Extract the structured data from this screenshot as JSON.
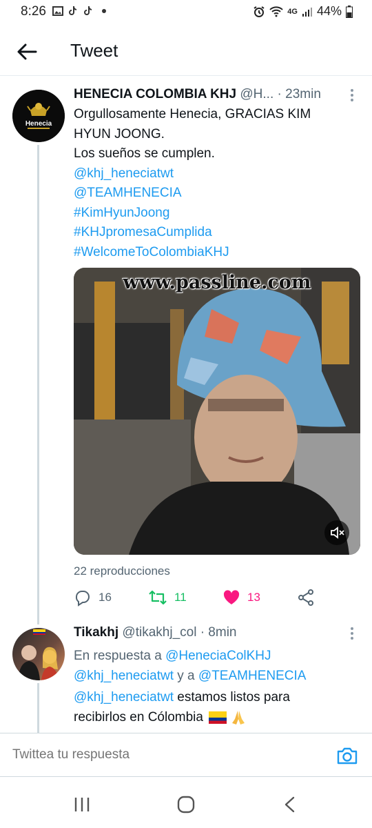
{
  "status_bar": {
    "time": "8:26",
    "network": "4G",
    "battery": "44%"
  },
  "header": {
    "title": "Tweet"
  },
  "tweet": {
    "author_name": "HENECIA COLOMBIA KHJ",
    "author_handle": "@H...",
    "time": "· 23min",
    "text_line1": "Orgullosamente Henecia, GRACIAS KIM",
    "text_line2": "HYUN JOONG.",
    "text_line3": "Los sueños se cumplen.",
    "links": [
      "@khj_heneciatwt",
      "@TEAMHENECIA",
      "#KimHyunJoong",
      "#KHJpromesaCumplida",
      "#WelcomeToColombiaKHJ"
    ],
    "avatar_text": "Henecia",
    "media_watermark": "www.passline.com",
    "views": "22 reproducciones",
    "reply_count": "16",
    "retweet_count": "11",
    "like_count": "13"
  },
  "reply": {
    "author_name": "Tikakhj",
    "author_handle": "@tikakhj_col",
    "time": "· 8min",
    "reply_prefix": "En respuesta a",
    "reply_mention1": "@HeneciaColKHJ",
    "reply_mention2": "@khj_heneciatwt",
    "reply_and": "y a",
    "reply_mention3": "@TEAMHENECIA",
    "text_mention": "@khj_heneciatwt",
    "text_part1": "estamos listos para",
    "text_part2": "recibirlos en Cólombia"
  },
  "composer": {
    "placeholder": "Twittea tu respuesta"
  },
  "colors": {
    "link": "#1d9bf0",
    "retweet": "#17bf63",
    "like": "#f91880",
    "secondary": "#536471"
  }
}
